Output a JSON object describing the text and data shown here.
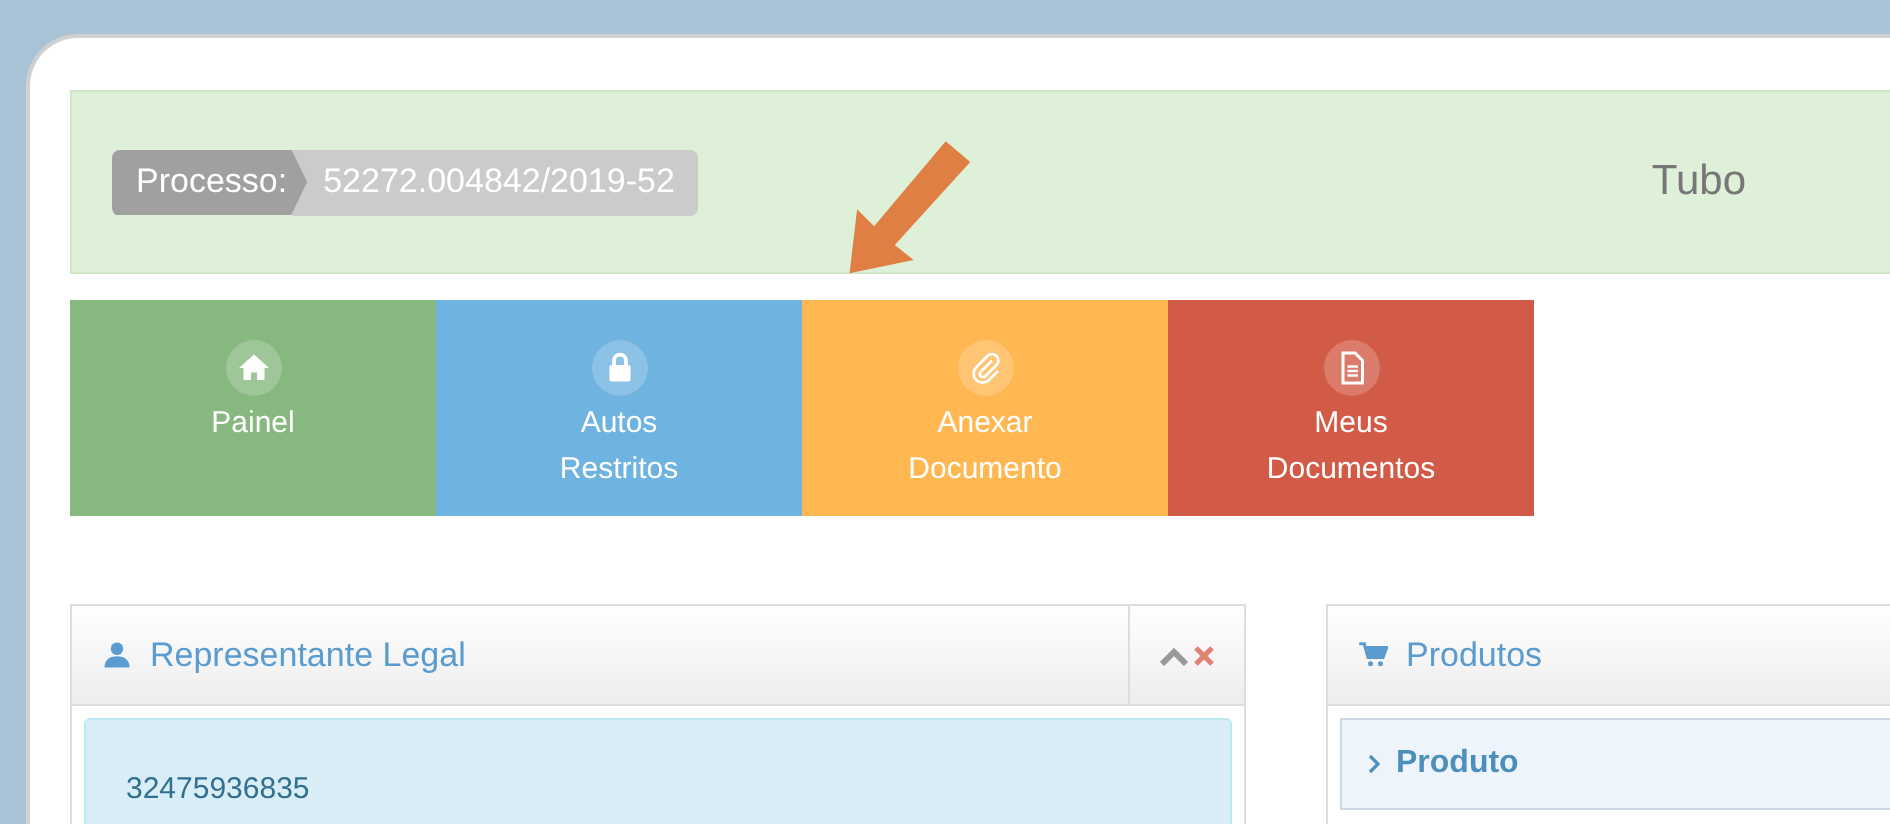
{
  "banner": {
    "process_label": "Processo:",
    "process_number": "52272.004842/2019-52",
    "title": "Tubo"
  },
  "tiles": [
    {
      "kind": "home",
      "label": "Painel",
      "color": "#87b87f"
    },
    {
      "kind": "lock",
      "label": "Autos Restritos",
      "color": "#6fb3e0"
    },
    {
      "kind": "clip",
      "label": "Anexar Documento",
      "color": "#ffb752"
    },
    {
      "kind": "file",
      "label": "Meus Documentos",
      "color": "#d15b47"
    }
  ],
  "panels": [
    {
      "kind": "user",
      "title": "Representante Legal",
      "controls": true,
      "items": [
        {
          "kind": "alert",
          "text": "32475936835"
        }
      ]
    },
    {
      "kind": "cart",
      "title": "Produtos",
      "controls": false,
      "items": [
        {
          "kind": "accordion",
          "text": "Produto"
        }
      ]
    }
  ]
}
